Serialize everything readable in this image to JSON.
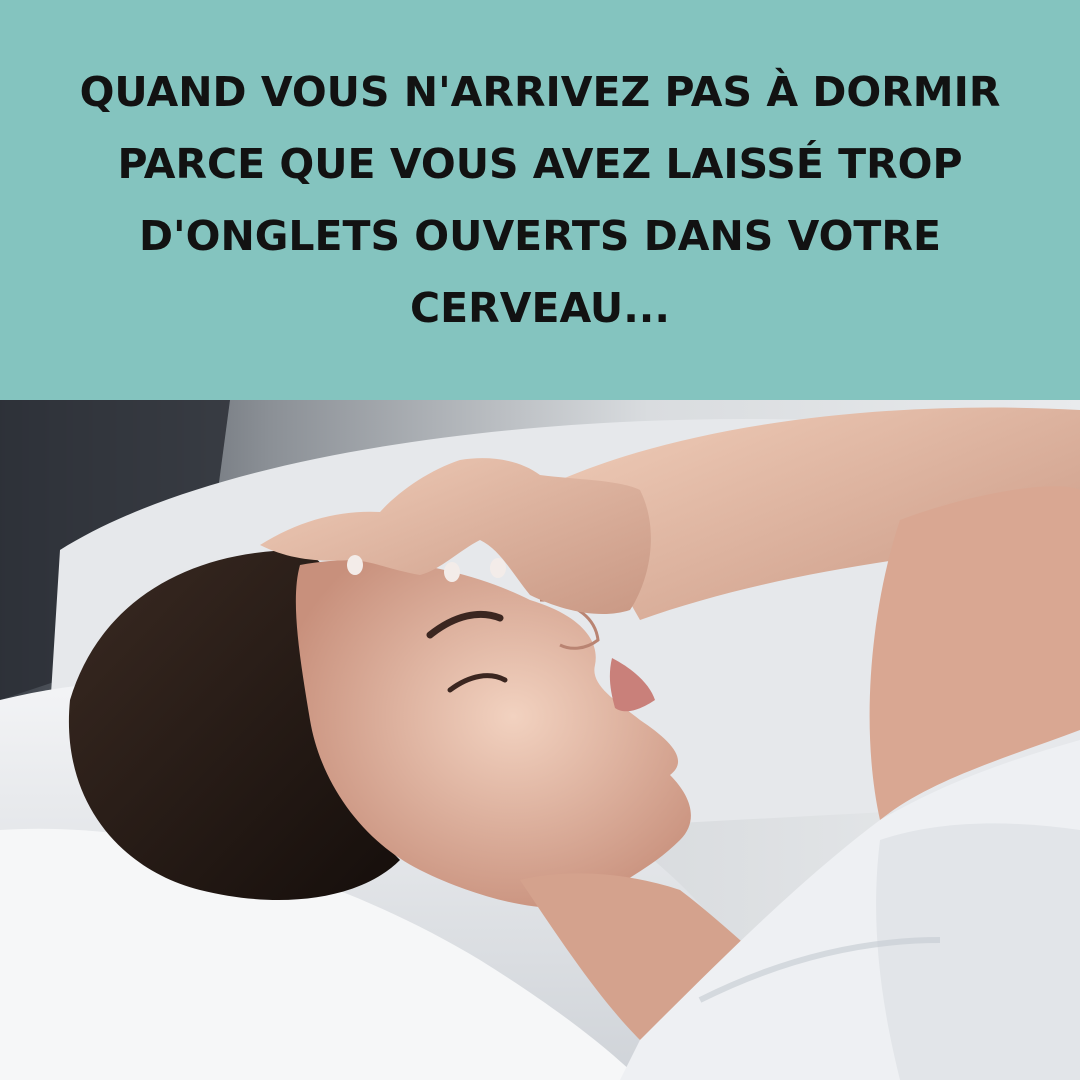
{
  "caption": {
    "lines": [
      "QUAND VOUS N'ARRIVEZ PAS À DORMIR",
      "PARCE QUE VOUS AVEZ LAISSÉ TROP",
      "D'ONGLETS OUVERTS DANS VOTRE",
      "CERVEAU..."
    ]
  },
  "colors": {
    "band": "#84c4bf",
    "caption_text": "#121212",
    "pillow": "#eef0f2",
    "hair": "#2a1d18",
    "skin": "#e3b8a3"
  }
}
